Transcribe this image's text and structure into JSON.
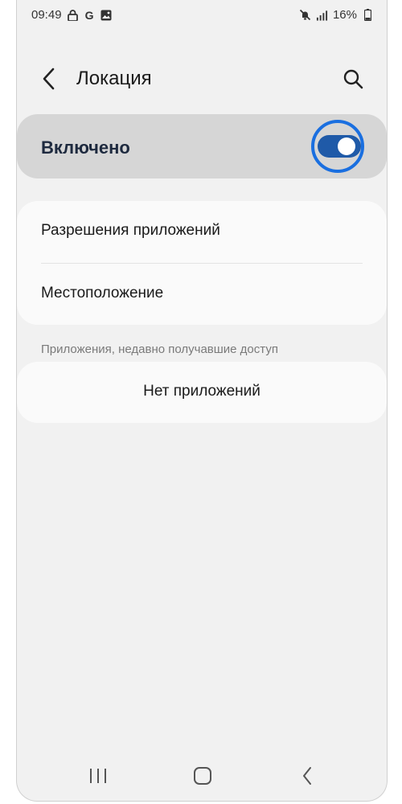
{
  "status_bar": {
    "time": "09:49",
    "battery": "16%",
    "icons": [
      "lock-icon",
      "google-icon",
      "gallery-icon",
      "mute-icon",
      "signal-icon",
      "battery-icon"
    ],
    "google_letter": "G"
  },
  "header": {
    "title": "Локация",
    "back_icon": "back-arrow-icon",
    "search_icon": "search-icon"
  },
  "master_toggle": {
    "label": "Включено",
    "enabled": true,
    "accent_color": "#1f5aa8",
    "highlight_color": "#1a6fe0"
  },
  "settings": {
    "items": [
      {
        "label": "Разрешения приложений"
      },
      {
        "label": "Местоположение"
      }
    ]
  },
  "recent_access": {
    "header": "Приложения, недавно получавшие доступ",
    "empty_text": "Нет приложений"
  },
  "nav_bar": {
    "buttons": [
      "recents-icon",
      "home-icon",
      "back-icon"
    ]
  }
}
